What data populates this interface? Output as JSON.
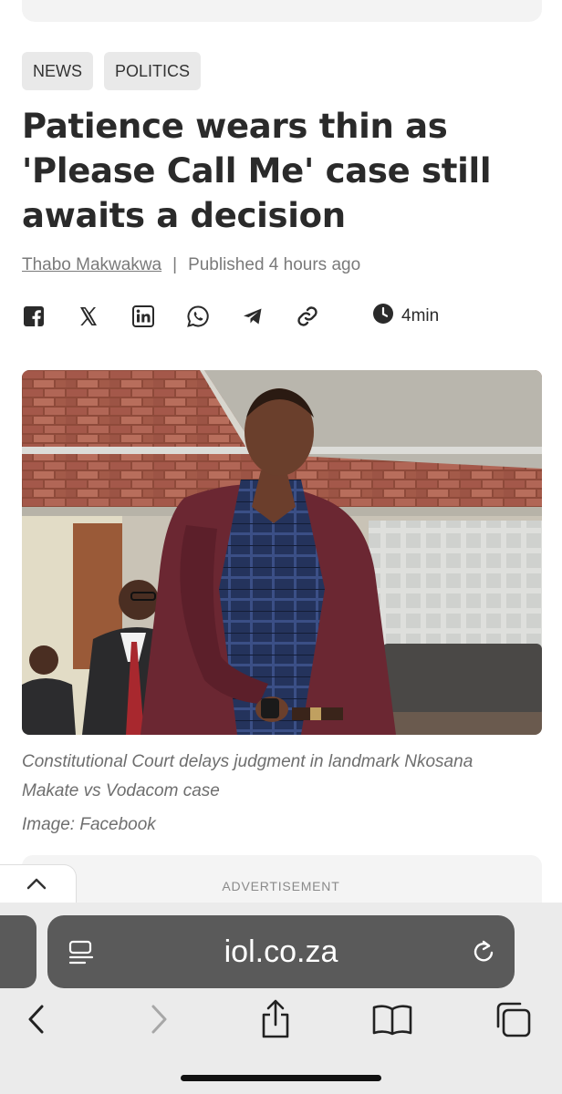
{
  "tags": [
    "NEWS",
    "POLITICS"
  ],
  "article": {
    "title": "Patience wears thin as 'Please Call Me' case still awaits a decision",
    "author": "Thabo Makwakwa",
    "separator": "|",
    "published": "Published 4 hours ago",
    "read_time": "4min",
    "caption": "Constitutional Court delays judgment in landmark Nkosana Makate vs Vodacom case",
    "image_credit": "Image: Facebook"
  },
  "share_icons": [
    "facebook-icon",
    "x-icon",
    "linkedin-icon",
    "whatsapp-icon",
    "telegram-icon",
    "link-icon"
  ],
  "advertisement_label": "ADVERTISEMENT",
  "browser": {
    "url": "iol.co.za"
  },
  "colors": {
    "text_dark": "#2a2a2a",
    "text_muted": "#7a7a7a",
    "tag_bg": "#e9e9e9",
    "urlbar_bg": "#5a5a5a",
    "toolbar_bg": "#ebebeb"
  }
}
